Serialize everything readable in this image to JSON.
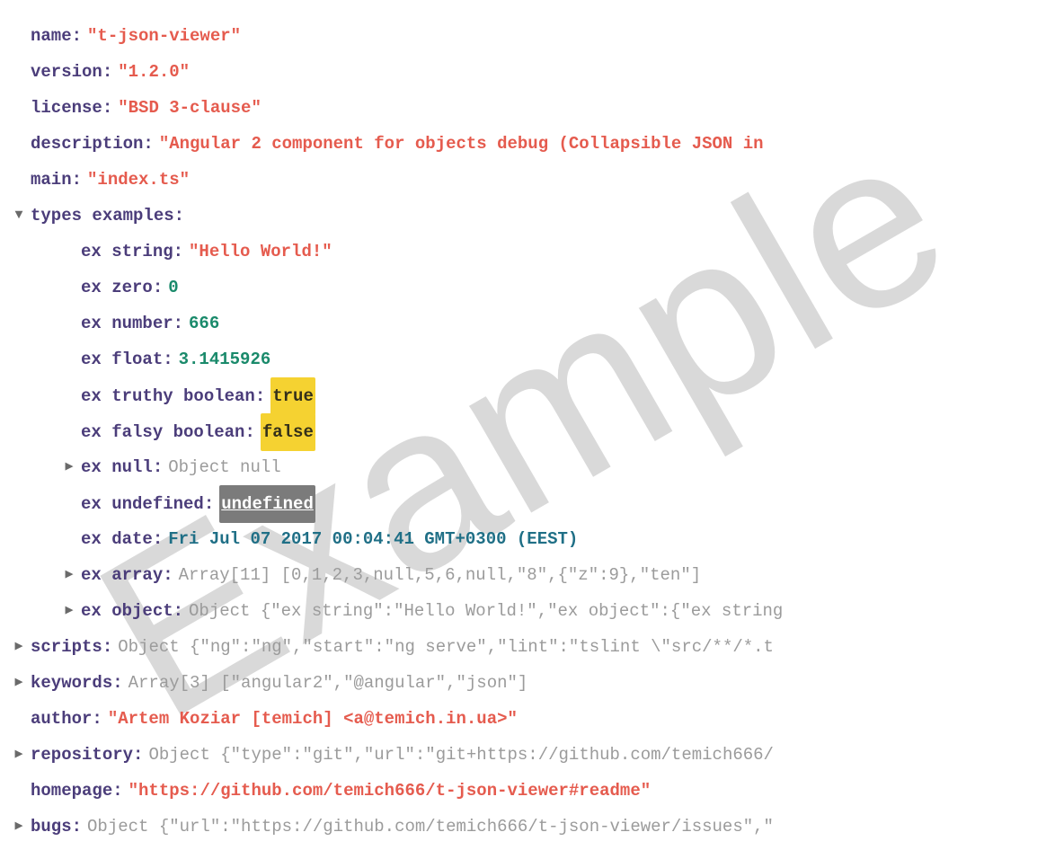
{
  "watermark": "Example",
  "root": {
    "name": {
      "k": "name",
      "v": "\"t-json-viewer\""
    },
    "version": {
      "k": "version",
      "v": "\"1.2.0\""
    },
    "license": {
      "k": "license",
      "v": "\"BSD 3-clause\""
    },
    "description": {
      "k": "description",
      "v": "\"Angular 2 component for objects debug (Collapsible JSON in "
    },
    "main": {
      "k": "main",
      "v": "\"index.ts\""
    },
    "types_examples": {
      "k": "types examples",
      "children": {
        "ex_string": {
          "k": "ex string",
          "v": "\"Hello World!\""
        },
        "ex_zero": {
          "k": "ex zero",
          "v": "0"
        },
        "ex_number": {
          "k": "ex number",
          "v": "666"
        },
        "ex_float": {
          "k": "ex float",
          "v": "3.1415926"
        },
        "ex_truthy": {
          "k": "ex truthy boolean",
          "v": "true"
        },
        "ex_falsy": {
          "k": "ex falsy boolean",
          "v": "false"
        },
        "ex_null": {
          "k": "ex null",
          "v": "Object null"
        },
        "ex_undef": {
          "k": "ex undefined",
          "v": "undefined"
        },
        "ex_date": {
          "k": "ex date",
          "v": "Fri Jul 07 2017 00:04:41 GMT+0300 (EEST)"
        },
        "ex_array": {
          "k": "ex array",
          "v": "Array[11] [0,1,2,3,null,5,6,null,\"8\",{\"z\":9},\"ten\"]"
        },
        "ex_object": {
          "k": "ex object",
          "v": "Object {\"ex string\":\"Hello World!\",\"ex object\":{\"ex string"
        }
      }
    },
    "scripts": {
      "k": "scripts",
      "v": "Object {\"ng\":\"ng\",\"start\":\"ng serve\",\"lint\":\"tslint \\\"src/**/*.t"
    },
    "keywords": {
      "k": "keywords",
      "v": "Array[3] [\"angular2\",\"@angular\",\"json\"]"
    },
    "author": {
      "k": "author",
      "v": "\"Artem Koziar [temich] <a@temich.in.ua>\""
    },
    "repository": {
      "k": "repository",
      "v": "Object {\"type\":\"git\",\"url\":\"git+https://github.com/temich666/"
    },
    "homepage": {
      "k": "homepage",
      "v": "\"https://github.com/temich666/t-json-viewer#readme\""
    },
    "bugs": {
      "k": "bugs",
      "v": "Object {\"url\":\"https://github.com/temich666/t-json-viewer/issues\",\""
    }
  }
}
